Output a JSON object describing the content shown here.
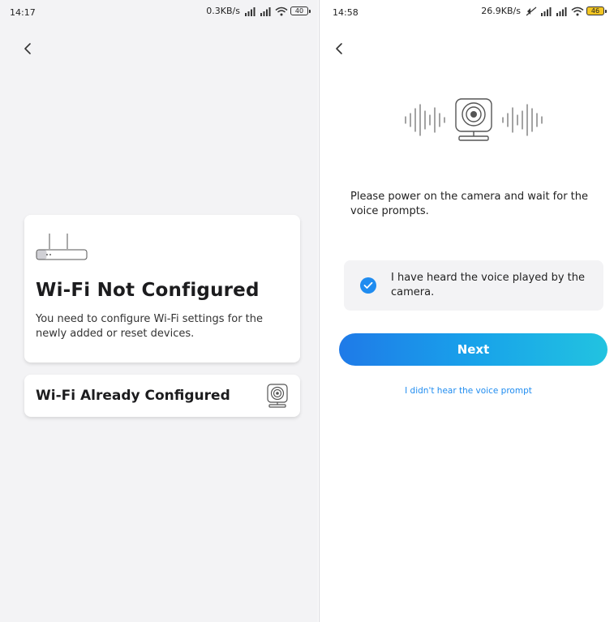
{
  "left": {
    "status": {
      "time": "14:17",
      "net_speed": "0.3KB/s",
      "battery": "40"
    },
    "card_not_configured": {
      "title": "Wi-Fi Not Configured",
      "description": "You need to configure Wi-Fi settings for the newly added or reset devices."
    },
    "card_already_configured": {
      "title": "Wi-Fi Already Configured"
    }
  },
  "right": {
    "status": {
      "time": "14:58",
      "net_speed": "26.9KB/s",
      "battery": "46"
    },
    "instruction": "Please power on the camera and wait for the voice prompts.",
    "confirm_label": "I have heard the voice played by the camera.",
    "confirm_checked": true,
    "next_label": "Next",
    "help_link": "I didn't hear the voice prompt"
  },
  "colors": {
    "accent": "#1f8cf0",
    "gradient_start": "#1f7ae8",
    "gradient_end": "#22c3e0",
    "battery_right": "#f3c623"
  },
  "icons": [
    "back-arrow-icon",
    "router-icon",
    "camera-icon",
    "sound-wave-icon",
    "check-icon",
    "wifi-icon",
    "signal-icon",
    "battery-icon"
  ]
}
